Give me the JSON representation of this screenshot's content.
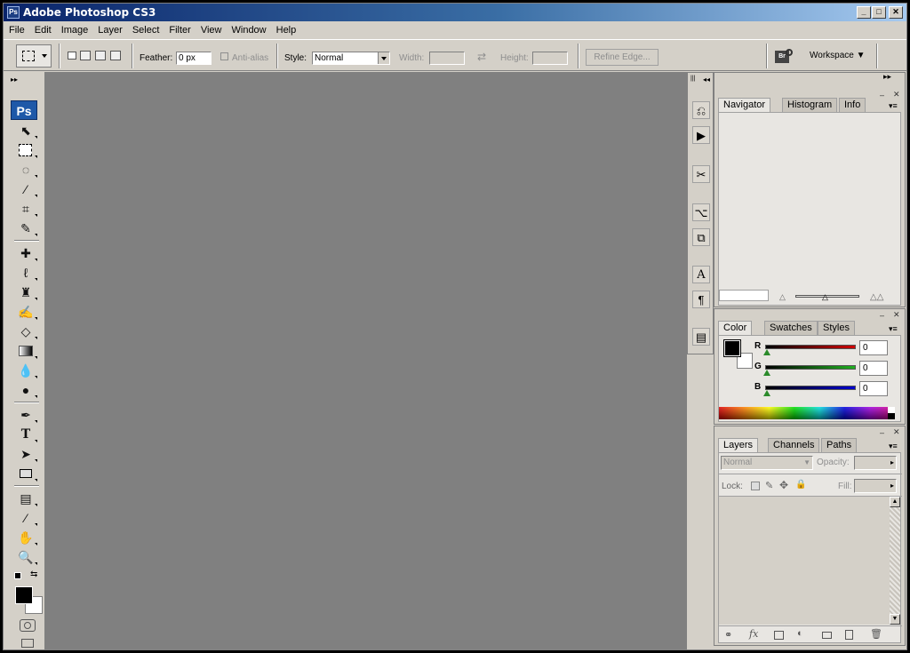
{
  "window": {
    "title": "Adobe Photoshop CS3",
    "app_badge": "Ps"
  },
  "menu": [
    "File",
    "Edit",
    "Image",
    "Layer",
    "Select",
    "Filter",
    "View",
    "Window",
    "Help"
  ],
  "options": {
    "feather_label": "Feather:",
    "feather_value": "0 px",
    "antialias_label": "Anti-alias",
    "style_label": "Style:",
    "style_value": "Normal",
    "width_label": "Width:",
    "height_label": "Height:",
    "refine_edge_label": "Refine Edge...",
    "workspace_label": "Workspace",
    "bridge_badge": "Br"
  },
  "tools": {
    "logo": "Ps"
  },
  "navigator_panel": {
    "tabs": [
      "Navigator",
      "Histogram",
      "Info"
    ]
  },
  "color_panel": {
    "tabs": [
      "Color",
      "Swatches",
      "Styles"
    ],
    "r_label": "R",
    "g_label": "G",
    "b_label": "B",
    "r_value": "0",
    "g_value": "0",
    "b_value": "0",
    "colors": {
      "r": "#d00000",
      "g": "#20b020",
      "b": "#0000d0"
    }
  },
  "layers_panel": {
    "tabs": [
      "Layers",
      "Channels",
      "Paths"
    ],
    "blend_mode": "Normal",
    "opacity_label": "Opacity:",
    "lock_label": "Lock:",
    "fill_label": "Fill:"
  }
}
